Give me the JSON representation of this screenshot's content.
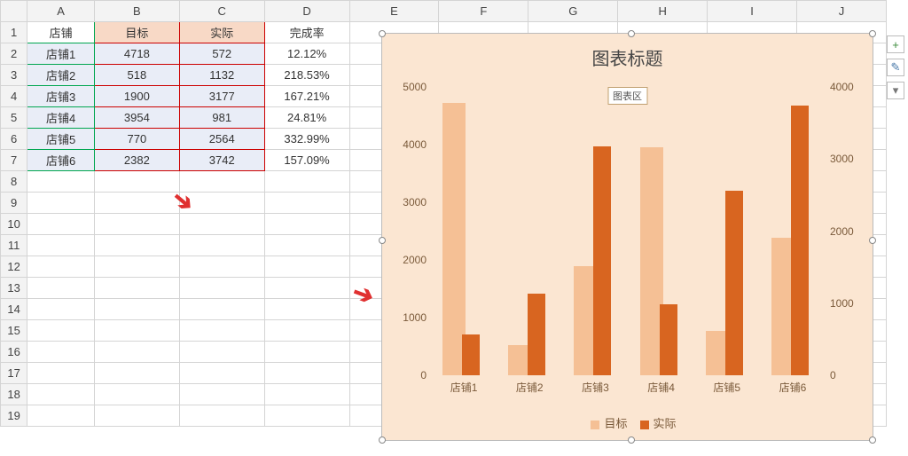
{
  "columns": [
    "A",
    "B",
    "C",
    "D",
    "E",
    "F",
    "G",
    "H",
    "I",
    "J"
  ],
  "row_count": 19,
  "table": {
    "headers": {
      "A": "店铺",
      "B": "目标",
      "C": "实际",
      "D": "完成率"
    },
    "rows": [
      {
        "A": "店铺1",
        "B": "4718",
        "C": "572",
        "D": "12.12%"
      },
      {
        "A": "店铺2",
        "B": "518",
        "C": "1132",
        "D": "218.53%"
      },
      {
        "A": "店铺3",
        "B": "1900",
        "C": "3177",
        "D": "167.21%"
      },
      {
        "A": "店铺4",
        "B": "3954",
        "C": "981",
        "D": "24.81%"
      },
      {
        "A": "店铺5",
        "B": "770",
        "C": "2564",
        "D": "332.99%"
      },
      {
        "A": "店铺6",
        "B": "2382",
        "C": "3742",
        "D": "157.09%"
      }
    ]
  },
  "chart_data": {
    "type": "bar",
    "title": "图表标题",
    "plot_area_label": "图表区",
    "categories": [
      "店铺1",
      "店铺2",
      "店铺3",
      "店铺4",
      "店铺5",
      "店铺6"
    ],
    "series": [
      {
        "name": "目标",
        "axis": "primary",
        "values": [
          4718,
          518,
          1900,
          3954,
          770,
          2382
        ],
        "color": "#f5c095"
      },
      {
        "name": "实际",
        "axis": "secondary",
        "values": [
          572,
          1132,
          3177,
          981,
          2564,
          3742
        ],
        "color": "#d86520"
      }
    ],
    "primary_axis": {
      "min": 0,
      "max": 5000,
      "step": 1000
    },
    "secondary_axis": {
      "min": 0,
      "max": 4000,
      "step": 1000
    },
    "legend_position": "bottom"
  },
  "side_buttons": [
    {
      "name": "chart-elements-button",
      "glyph": "+",
      "color": "#3a8a3a"
    },
    {
      "name": "chart-styles-button",
      "glyph": "✎",
      "color": "#4a7aaa"
    },
    {
      "name": "chart-filters-button",
      "glyph": "▾",
      "color": "#777"
    }
  ]
}
